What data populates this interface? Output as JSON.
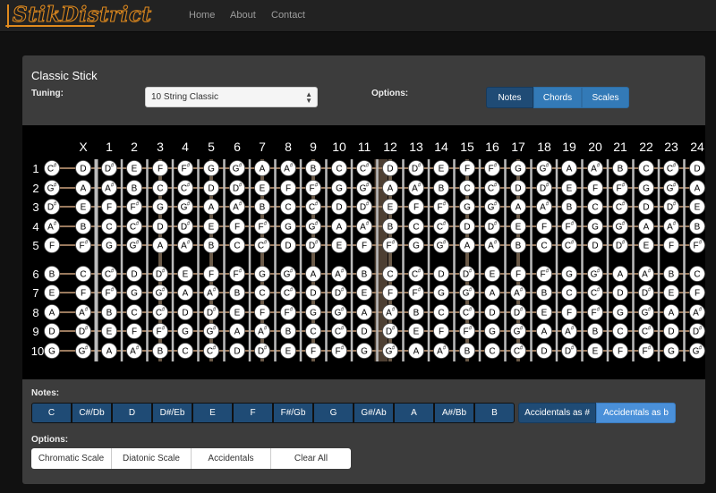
{
  "navbar": {
    "brand": "StikDistrict",
    "links": [
      "Home",
      "About",
      "Contact"
    ]
  },
  "panel": {
    "title": "Classic Stick",
    "tuning_label": "Tuning:",
    "tuning_value": "10 String Classic",
    "options_label": "Options:",
    "view_buttons": [
      {
        "label": "Notes",
        "active": true
      },
      {
        "label": "Chords",
        "active": false
      },
      {
        "label": "Scales",
        "active": false
      }
    ]
  },
  "fretboard": {
    "fret_labels": [
      "X",
      "1",
      "2",
      "3",
      "4",
      "5",
      "6",
      "7",
      "8",
      "9",
      "10",
      "11",
      "12",
      "13",
      "14",
      "15",
      "16",
      "17",
      "18",
      "19",
      "20",
      "21",
      "22",
      "23",
      "24"
    ],
    "string_labels": [
      "1",
      "2",
      "3",
      "4",
      "5",
      "6",
      "7",
      "8",
      "9",
      "10"
    ],
    "open_notes": [
      "C#",
      "G#",
      "D#",
      "A#",
      "F",
      "B",
      "E",
      "A",
      "D",
      "G"
    ],
    "chromatic": [
      "C",
      "C#",
      "D",
      "D#",
      "E",
      "F",
      "F#",
      "G",
      "G#",
      "A",
      "A#",
      "B"
    ],
    "colors": {
      "board": "#000000",
      "fret_wire": "#bcbcbc",
      "string": "#9a7a5e",
      "marker_stripe": "#6b5a48",
      "note_fill": "#ffffff",
      "note_text": "#000000"
    }
  },
  "notes_section": {
    "label": "Notes:",
    "notes": [
      "C",
      "C#/Db",
      "D",
      "D#/Eb",
      "E",
      "F",
      "F#/Gb",
      "G",
      "G#/Ab",
      "A",
      "A#/Bb",
      "B"
    ],
    "accidental_buttons": [
      {
        "label": "Accidentals as #",
        "active": false
      },
      {
        "label": "Accidentals as b",
        "active": true
      }
    ]
  },
  "options_section": {
    "label": "Options:",
    "buttons": [
      "Chromatic Scale",
      "Diatonic Scale",
      "Accidentals",
      "Clear All"
    ]
  }
}
